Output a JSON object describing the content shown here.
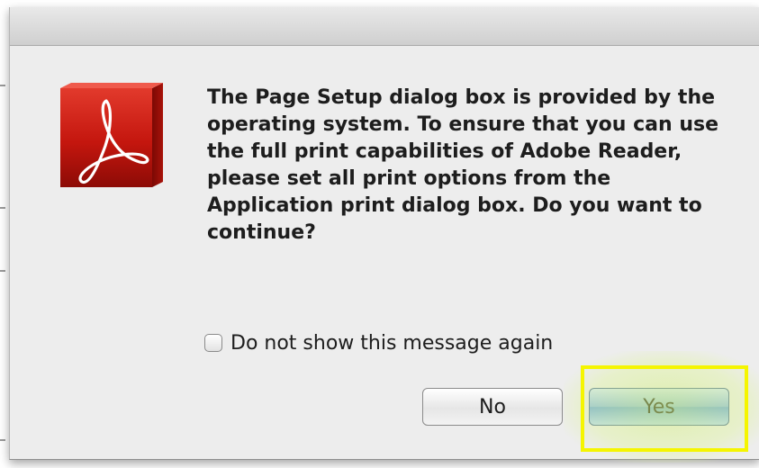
{
  "dialog": {
    "message": "The Page Setup dialog box is provided by the operating system. To ensure that you can use the full print capabilities of Adobe Reader, please set all print options from the Application print dialog box. Do you want to continue?",
    "icon": "adobe-reader-icon",
    "checkbox_label": "Do not show this message again",
    "checkbox_checked": false,
    "no_label": "No",
    "yes_label": "Yes",
    "default_button": "Yes"
  },
  "colors": {
    "icon_red": "#c8170f",
    "highlight_yellow": "#f5f500",
    "default_button_blue": "#8fbbe9"
  }
}
